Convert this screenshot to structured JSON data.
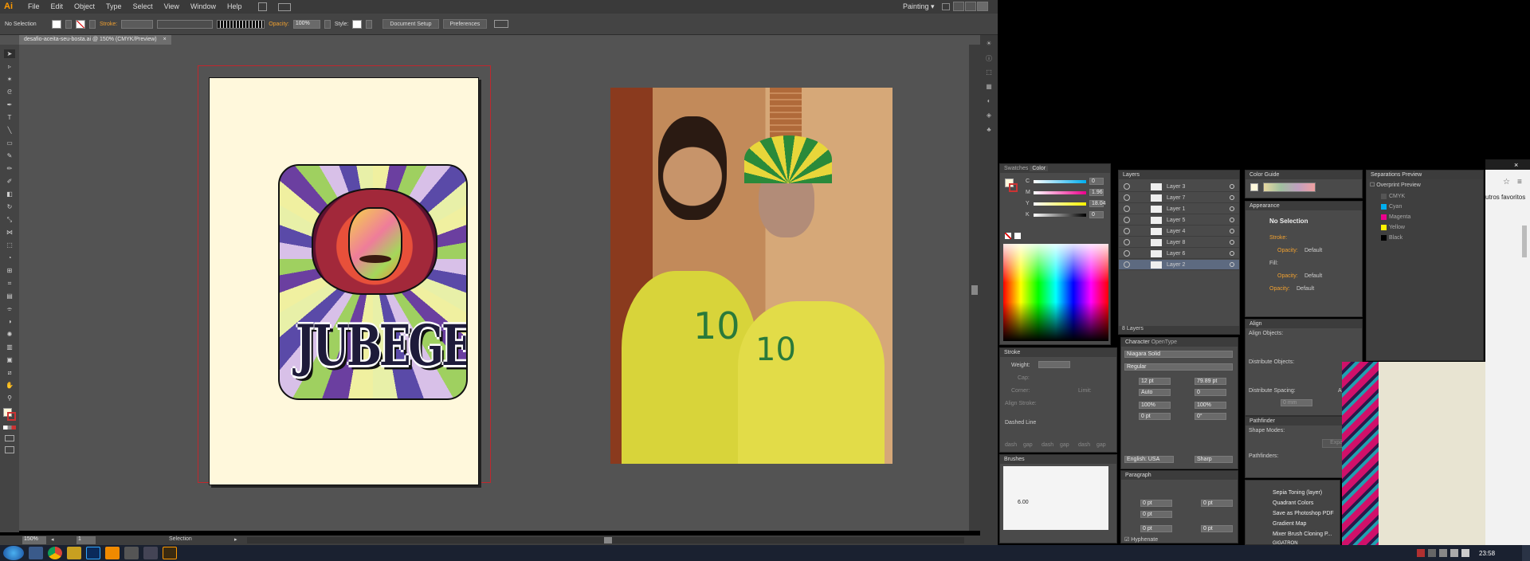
{
  "app": {
    "logo": "Ai",
    "menus": [
      "File",
      "Edit",
      "Object",
      "Type",
      "Select",
      "View",
      "Window",
      "Help"
    ],
    "workspace": "Painting"
  },
  "control": {
    "selection": "No Selection",
    "stroke_label": "Stroke:",
    "opacity_label": "Opacity:",
    "opacity_value": "100%",
    "style_label": "Style:",
    "document_setup": "Document Setup",
    "preferences": "Preferences"
  },
  "document": {
    "tab_title": "desafio-aceita-seu-bosta.ai @ 150% (CMYK/Preview)",
    "artwork_text": "JUBEGE",
    "zoom": "150%",
    "page": "1",
    "status_tool": "Selection"
  },
  "colors": {
    "accent": "#f0a030",
    "bg_dark": "#535353",
    "panel": "#4a4a4a",
    "artboard": "#fff8dc",
    "bleed": "#c0272d"
  },
  "color_panel": {
    "tabs": [
      "Swatches",
      "Color"
    ],
    "channels": [
      {
        "name": "C",
        "value": "0"
      },
      {
        "name": "M",
        "value": "1.96"
      },
      {
        "name": "Y",
        "value": "18.04"
      },
      {
        "name": "K",
        "value": "0"
      }
    ],
    "unit": "%"
  },
  "layers_panel": {
    "title": "Layers",
    "layers": [
      "Layer 3",
      "Layer 7",
      "Layer 1",
      "Layer 5",
      "Layer 4",
      "Layer 8",
      "Layer 6",
      "Layer 2"
    ],
    "footer": "8 Layers"
  },
  "color_guide": {
    "title": "Color Guide"
  },
  "appearance": {
    "title": "Appearance",
    "selection": "No Selection",
    "stroke": "Stroke:",
    "fill": "Fill:",
    "opacity": "Opacity:",
    "default": "Default"
  },
  "separations": {
    "title": "Separations Preview",
    "overprint": "Overprint Preview",
    "plates": [
      "CMYK",
      "Cyan",
      "Magenta",
      "Yellow",
      "Black"
    ]
  },
  "stroke_panel": {
    "title": "Stroke",
    "weight": "Weight:",
    "cap": "Cap:",
    "corner": "Corner:",
    "limit": "Limit:",
    "align": "Align Stroke:",
    "dashed": "Dashed Line",
    "dash_labels": [
      "dash",
      "gap",
      "dash",
      "gap",
      "dash",
      "gap"
    ]
  },
  "character": {
    "tabs": [
      "Character",
      "OpenType"
    ],
    "font": "Niagara Solid",
    "style": "Regular",
    "size": "12 pt",
    "leading": "79.89 pt",
    "tracking": "Auto",
    "kerning": "0",
    "hscale": "100%",
    "vscale": "100%",
    "baseline": "0 pt",
    "rotation": "0°",
    "language": "English: USA",
    "aa": "Sharp"
  },
  "align_panel": {
    "title": "Align",
    "objects": "Align Objects:",
    "distribute": "Distribute Objects:",
    "spacing": "Distribute Spacing:",
    "align_to": "Align To:",
    "spacing_value": "0 mm"
  },
  "pathfinder": {
    "title": "Pathfinder",
    "shape_modes": "Shape Modes:",
    "pathfinders": "Pathfinders:",
    "expand": "Expand"
  },
  "actions": [
    "Sepia Toning (layer)",
    "Quadrant Colors",
    "Save as Photoshop PDF",
    "Gradient Map",
    "Mixer Brush Cloning P...",
    "GIGATRON"
  ],
  "brushes": {
    "title": "Brushes",
    "size": "6.00"
  },
  "paragraph": {
    "title": "Paragraph",
    "values": [
      "0 pt",
      "0 pt",
      "0 pt",
      "0 pt",
      "0 pt"
    ],
    "hyphenate": "Hyphenate"
  },
  "browser": {
    "bookmarks": "utros favoritos"
  },
  "taskbar": {
    "time": "23:58"
  }
}
